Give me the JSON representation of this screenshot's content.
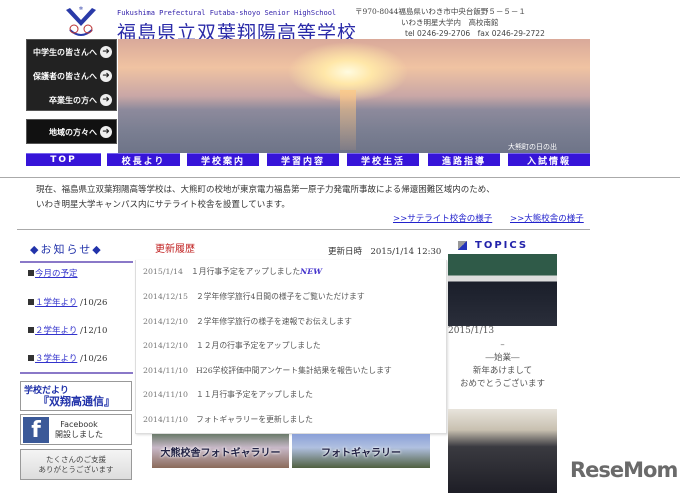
{
  "header": {
    "title_en": "Fukushima Prefectural Futaba-shoyo Senior HighSchool",
    "title_jp": "福島県立双葉翔陽高等学校",
    "address1": "〒970-8044福島県いわき市中央台飯野５－５－１",
    "address2": "いわき明星大学内　高校南館",
    "phone": "tel 0246-29-2706　fax 0246-29-2722"
  },
  "left_nav": [
    "中学生の皆さんへ",
    "保護者の皆さんへ",
    "卒業生の方へ",
    "地域の方々へ"
  ],
  "banner_caption": "大熊町の日の出",
  "nav": [
    "TOP",
    "校長より",
    "学校案内",
    "学習内容",
    "学校生活",
    "進路指導",
    "入試情報"
  ],
  "intro": {
    "line1": "現在、福島県立双葉翔陽高等学校は、大熊町の校地が東京電力福島第一原子力発電所事故による帰還困難区域内のため、",
    "line2": "いわき明星大学キャンパス内にサテライト校舎を設置しています。",
    "link1": ">>サテライト校舎の様子",
    "link2": ">>大熊校舎の様子"
  },
  "notices": {
    "heading": "◆お知らせ◆",
    "items": [
      {
        "label": "今月の予定",
        "date": ""
      },
      {
        "label": "１学年より",
        "date": " /10/26"
      },
      {
        "label": "２学年より",
        "date": " /12/10"
      },
      {
        "label": "３学年より",
        "date": " /10/26"
      }
    ]
  },
  "banners": {
    "dayori1": "学校だより",
    "dayori2": "『双翔高通信』",
    "fb1": "Facebook",
    "fb2": "開設しました",
    "support1": "たくさんのご支援",
    "support2": "ありがとうございます"
  },
  "updates": {
    "heading": "更新履歴",
    "updated": "更新日時　2015/1/14 12:30",
    "new_label": "NEW",
    "items": [
      {
        "date": "2015/1/14",
        "text": "１月行事予定をアップしました"
      },
      {
        "date": "2014/12/15",
        "text": "２学年修学旅行4日間の様子をご覧いただけます"
      },
      {
        "date": "2014/12/10",
        "text": "２学年修学旅行の様子を速報でお伝えします"
      },
      {
        "date": "2014/12/10",
        "text": "１２月の行事予定をアップしました"
      },
      {
        "date": "2014/11/10",
        "text": "H26学校評価中間アンケート集計結果を報告いたします"
      },
      {
        "date": "2014/11/10",
        "text": "１１月行事予定をアップしました"
      },
      {
        "date": "2014/11/10",
        "text": "フォトギャラリーを更新しました"
      }
    ]
  },
  "gallery": [
    "大熊校舎フォトギャラリー",
    "フォトギャラリー"
  ],
  "topics": {
    "heading": "TOPICS",
    "date": "2015/1/13",
    "dash": "–",
    "line1": "―始業―",
    "line2": "新年あけまして",
    "line3": "おめでとうございます"
  },
  "watermark": "ReseMom"
}
